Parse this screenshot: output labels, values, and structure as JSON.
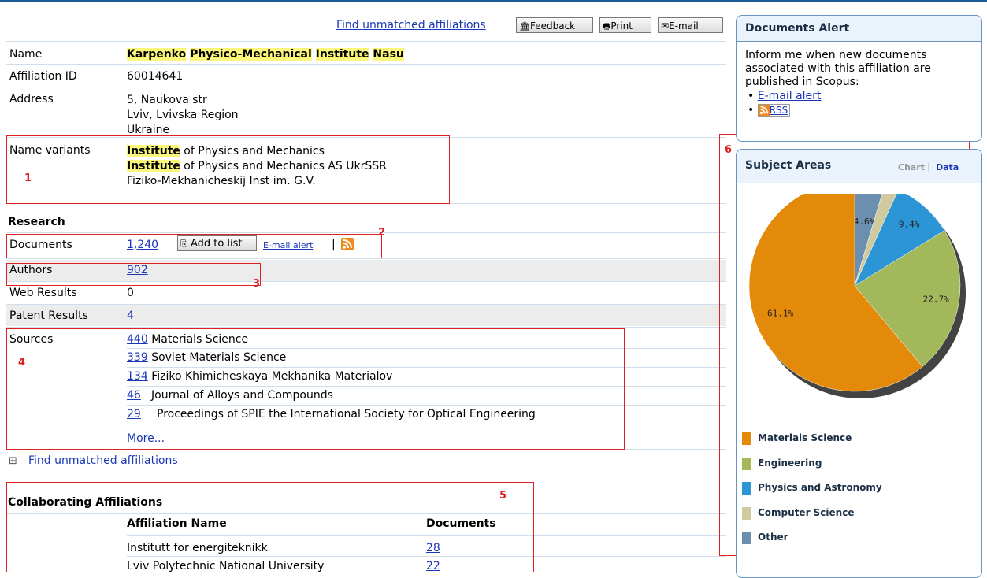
{
  "toolbar": {
    "find_unmatched": "Find unmatched affiliations",
    "feedback": "Feedback",
    "print": "Print",
    "email": "E-mail"
  },
  "profile": {
    "name_label": "Name",
    "name_parts": [
      "Karpenko",
      "Physico-Mechanical",
      "Institute",
      "Nasu"
    ],
    "affid_label": "Affiliation ID",
    "affid": "60014641",
    "address_label": "Address",
    "address_lines": [
      "5, Naukova str",
      "Lviv, Lvivska Region",
      "Ukraine"
    ],
    "variants_label": "Name variants",
    "variants": [
      {
        "hl": "Institute",
        "rest": " of Physics and Mechanics"
      },
      {
        "hl": "Institute",
        "rest": " of Physics and Mechanics AS UkrSSR"
      },
      {
        "hl": "",
        "rest": "Fiziko-Mekhanicheskij Inst im. G.V."
      }
    ]
  },
  "research": {
    "heading": "Research",
    "documents_label": "Documents",
    "documents": "1,240",
    "add_to_list": "Add to list",
    "email_alert": "E-mail alert",
    "sep": "|",
    "authors_label": "Authors",
    "authors": "902",
    "web_label": "Web Results",
    "web": "0",
    "patent_label": "Patent Results",
    "patent": "4",
    "sources_label": "Sources",
    "sources": [
      {
        "count": "440",
        "name": "Materials Science"
      },
      {
        "count": "339",
        "name": "Soviet Materials Science"
      },
      {
        "count": "134",
        "name": "Fiziko Khimicheskaya Mekhanika Materialov"
      },
      {
        "count": "46",
        "name": "Journal of Alloys and Compounds"
      },
      {
        "count": "29",
        "name": "Proceedings of SPIE the International Society for Optical Engineering"
      }
    ],
    "more": "More...",
    "expand_symbol": "⊞",
    "find_unmatched": "Find unmatched affiliations"
  },
  "collab": {
    "heading": "Collaborating Affiliations",
    "col_name": "Affiliation Name",
    "col_docs": "Documents",
    "rows": [
      {
        "name": "Institutt for energiteknikk",
        "docs": "28"
      },
      {
        "name": "Lviv Polytechnic National University",
        "docs": "22"
      }
    ]
  },
  "annotations": [
    "1",
    "2",
    "3",
    "4",
    "5",
    "6"
  ],
  "alert_panel": {
    "title": "Documents Alert",
    "text": "Inform me when new documents associated with this affiliation are published in Scopus:",
    "email_alert": "E-mail alert",
    "rss": "RSS"
  },
  "subject_panel": {
    "title": "Subject Areas",
    "tab_chart": "Chart",
    "tab_sep": "|",
    "tab_data": "Data"
  },
  "chart_data": {
    "type": "pie",
    "title": "",
    "slices": [
      {
        "label": "Other",
        "value": 4.6,
        "color": "#6a8faf",
        "label_text": "4.6%"
      },
      {
        "label": "Computer Science",
        "value": 2.2,
        "color": "#cfcaa0",
        "label_text": ""
      },
      {
        "label": "Physics and Astronomy",
        "value": 9.4,
        "color": "#2b95d6",
        "label_text": "9.4%"
      },
      {
        "label": "Engineering",
        "value": 22.7,
        "color": "#a2b85a",
        "label_text": "22.7%"
      },
      {
        "label": "Materials Science",
        "value": 61.1,
        "color": "#e38a0a",
        "label_text": "61.1%"
      }
    ],
    "legend": [
      {
        "label": "Materials Science",
        "color": "#e38a0a"
      },
      {
        "label": "Engineering",
        "color": "#a2b85a"
      },
      {
        "label": "Physics and Astronomy",
        "color": "#2b95d6"
      },
      {
        "label": "Computer Science",
        "color": "#cfcaa0"
      },
      {
        "label": "Other",
        "color": "#6a8faf"
      }
    ]
  }
}
